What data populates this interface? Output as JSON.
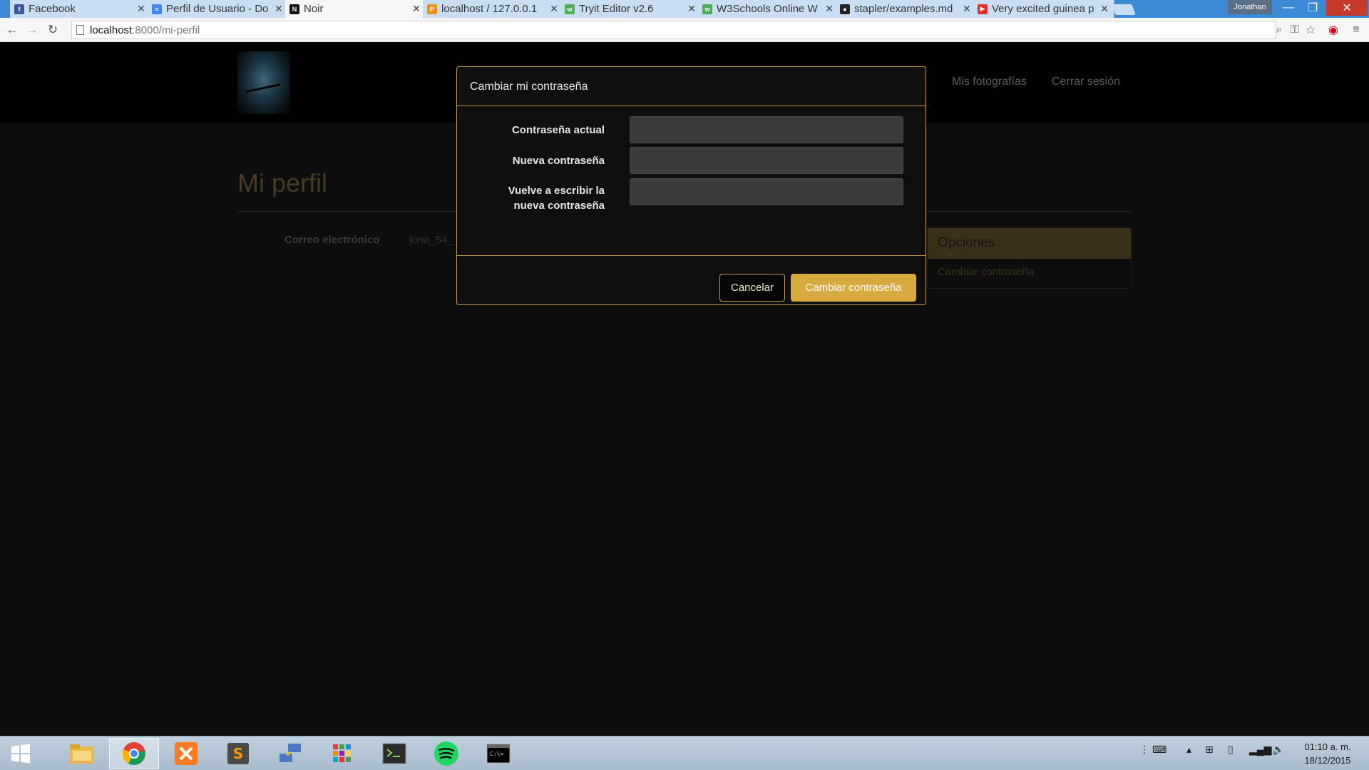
{
  "browser": {
    "tabs": [
      {
        "title": "Facebook",
        "favicon": "facebook-icon",
        "color": "#3b5998",
        "active": false
      },
      {
        "title": "Perfil de Usuario - Do",
        "favicon": "docs-icon",
        "color": "#4285f4",
        "active": false
      },
      {
        "title": "Noir",
        "favicon": "noir-icon",
        "color": "#111111",
        "active": true
      },
      {
        "title": "localhost / 127.0.0.1",
        "favicon": "phpmyadmin-icon",
        "color": "#f29111",
        "active": false
      },
      {
        "title": "Tryit Editor v2.6",
        "favicon": "w3schools-icon",
        "color": "#4caf50",
        "active": false
      },
      {
        "title": "W3Schools Online W",
        "favicon": "w3schools-icon",
        "color": "#4caf50",
        "active": false
      },
      {
        "title": "stapler/examples.md",
        "favicon": "github-icon",
        "color": "#222222",
        "active": false
      },
      {
        "title": "Very excited guinea p",
        "favicon": "youtube-icon",
        "color": "#e52d27",
        "active": false
      }
    ],
    "profile_name": "Jonathan",
    "url_host": "localhost",
    "url_path": ":8000/mi-perfil"
  },
  "site": {
    "nav_links": [
      "Mis fotografías",
      "Cerrar sesión"
    ]
  },
  "profile": {
    "title": "Mi perfil",
    "email_label": "Correo electrónico",
    "email_value": "jona_54_"
  },
  "options": {
    "heading": "Opciones",
    "link": "Cambiar contraseña"
  },
  "modal": {
    "title": "Cambiar mi contraseña",
    "current_label": "Contraseña actual",
    "new_label": "Nueva contraseña",
    "repeat_label_line1": "Vuelve a escribir la",
    "repeat_label_line2": "nueva contraseña",
    "current_value": "",
    "new_value": "",
    "repeat_value": "",
    "cancel_label": "Cancelar",
    "submit_label": "Cambiar contraseña"
  },
  "taskbar": {
    "apps": [
      "file-explorer-icon",
      "chrome-icon",
      "xampp-icon",
      "sublime-text-icon",
      "network-tool-icon",
      "apps-grid-icon",
      "terminal-icon",
      "spotify-icon",
      "console-icon"
    ],
    "time": "01:10 a. m.",
    "date": "18/12/2015"
  },
  "colors": {
    "accent": "#d8a93f",
    "modal_border": "#c29b52",
    "title_brown": "#6e5a37"
  }
}
